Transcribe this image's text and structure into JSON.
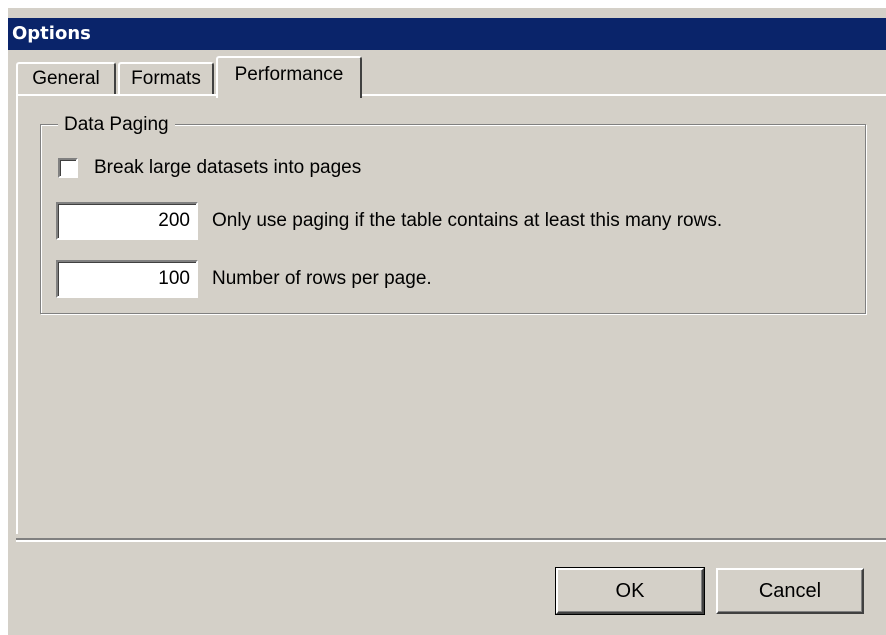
{
  "window": {
    "title": "Options"
  },
  "tabs": [
    {
      "label": "General",
      "active": false
    },
    {
      "label": "Formats",
      "active": false
    },
    {
      "label": "Performance",
      "active": true
    }
  ],
  "data_paging": {
    "group_label": "Data Paging",
    "break_checkbox": {
      "label": "Break large datasets into pages",
      "checked": false
    },
    "min_rows": {
      "value": "200",
      "description": "Only use paging if the table contains at least this many rows."
    },
    "rows_per_page": {
      "value": "100",
      "description": "Number of rows per page."
    }
  },
  "buttons": {
    "ok": "OK",
    "cancel": "Cancel"
  },
  "colors": {
    "title_bar": "#0a246a",
    "face": "#d4d0c8"
  }
}
